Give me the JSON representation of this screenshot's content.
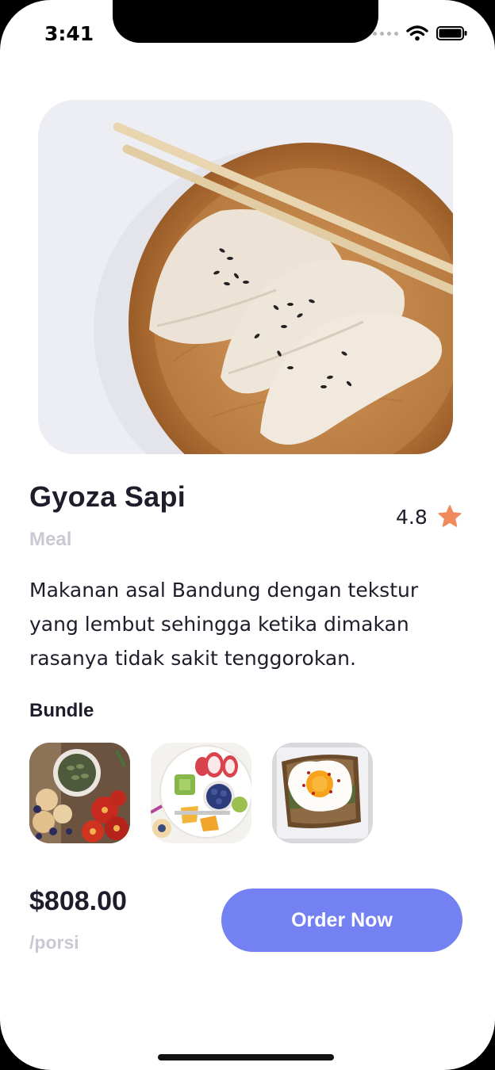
{
  "status_bar": {
    "time": "3:41",
    "icons": [
      "signal-dots-icon",
      "wifi-icon",
      "battery-icon"
    ]
  },
  "product": {
    "name": "Gyoza Sapi",
    "category": "Meal",
    "rating": "4.8",
    "description": "Makanan asal Bandung dengan tekstur yang lembut sehingga ketika dimakan rasanya tidak sakit tenggorokan.",
    "hero_image": "gyoza-dumplings-photo"
  },
  "bundle": {
    "title": "Bundle",
    "items": [
      "pumpkin-seeds-tomato-board-photo",
      "fruit-bowl-plate-photo",
      "fried-egg-toast-photo"
    ]
  },
  "footer": {
    "price": "$808.00",
    "unit": "/porsi",
    "order_label": "Order Now"
  },
  "colors": {
    "accent": "#7381f2",
    "star": "#f08a5d",
    "text": "#1d1d2b",
    "muted": "#c9c9d3"
  }
}
